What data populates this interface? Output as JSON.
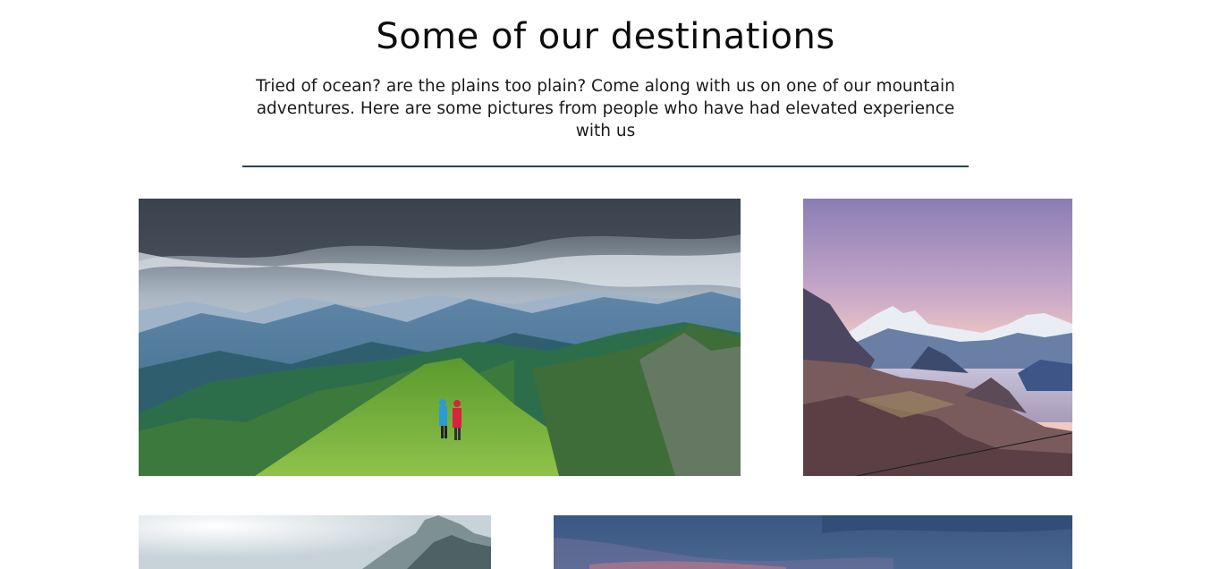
{
  "section": {
    "title": "Some of our destinations",
    "description": "Tried of ocean? are the plains too plain? Come along with us on one of our mountain adventures. Here are some pictures from people who have had elevated experience with us"
  },
  "gallery": {
    "photos": [
      {
        "subject": "green-ridge-hikers-photo"
      },
      {
        "subject": "snowy-peaks-pink-sky-photo"
      },
      {
        "subject": "misty-peak-photo"
      },
      {
        "subject": "dusk-sky-photo"
      }
    ]
  },
  "colors": {
    "divider": "#2c4257",
    "text": "#111111",
    "background": "#ffffff"
  }
}
